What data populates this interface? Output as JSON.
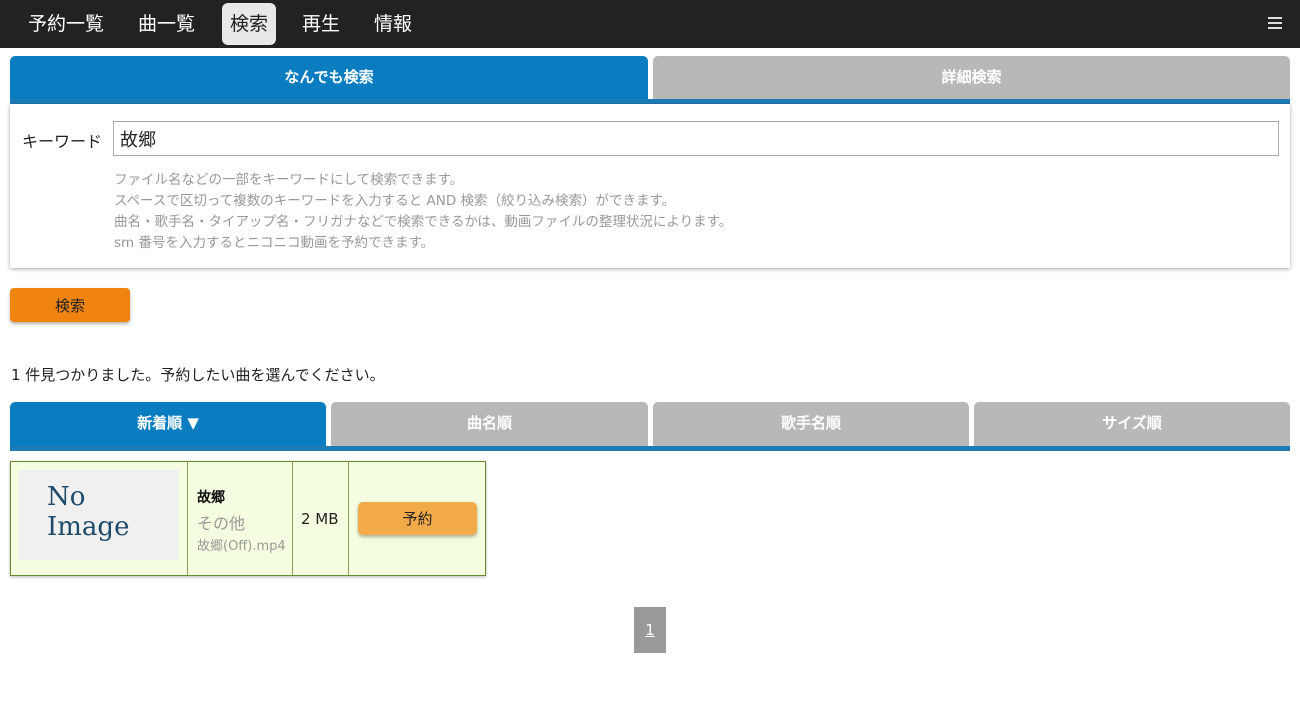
{
  "nav": {
    "items": [
      {
        "label": "予約一覧"
      },
      {
        "label": "曲一覧"
      },
      {
        "label": "検索"
      },
      {
        "label": "再生"
      },
      {
        "label": "情報"
      }
    ],
    "active": "検索",
    "menu_icon": "hamburger-menu-icon"
  },
  "search_tabs": [
    {
      "label": "なんでも検索",
      "active": true
    },
    {
      "label": "詳細検索",
      "active": false
    }
  ],
  "panel": {
    "keyword_label": "キーワード",
    "keyword_value": "故郷",
    "help": [
      "ファイル名などの一部をキーワードにして検索できます。",
      "スペースで区切って複数のキーワードを入力すると AND 検索（絞り込み検索）ができます。",
      "曲名・歌手名・タイアップ名・フリガナなどで検索できるかは、動画ファイルの整理状況によります。",
      "sm 番号を入力するとニコニコ動画を予約できます。"
    ]
  },
  "search_button": "検索",
  "result_message": "1 件見つかりました。予約したい曲を選んでください。",
  "sort_tabs": [
    {
      "label": "新着順 ▼",
      "active": true
    },
    {
      "label": "曲名順",
      "active": false
    },
    {
      "label": "歌手名順",
      "active": false
    },
    {
      "label": "サイズ順",
      "active": false
    }
  ],
  "results": [
    {
      "thumb_line1": "No",
      "thumb_line2": "Image",
      "title": "故郷",
      "artist": "その他",
      "file": "故郷(Off).mp4",
      "size": "2 MB",
      "reserve_label": "予約"
    }
  ],
  "pagination": {
    "pages": [
      "1"
    ],
    "current": "1"
  },
  "colors": {
    "navbar": "#222222",
    "tab_active": "#0a7cc0",
    "tab_inactive": "#b8b8b8",
    "search_button": "#f0840e",
    "reserve_button": "#f3aa48",
    "card_bg": "#f4fde0"
  }
}
